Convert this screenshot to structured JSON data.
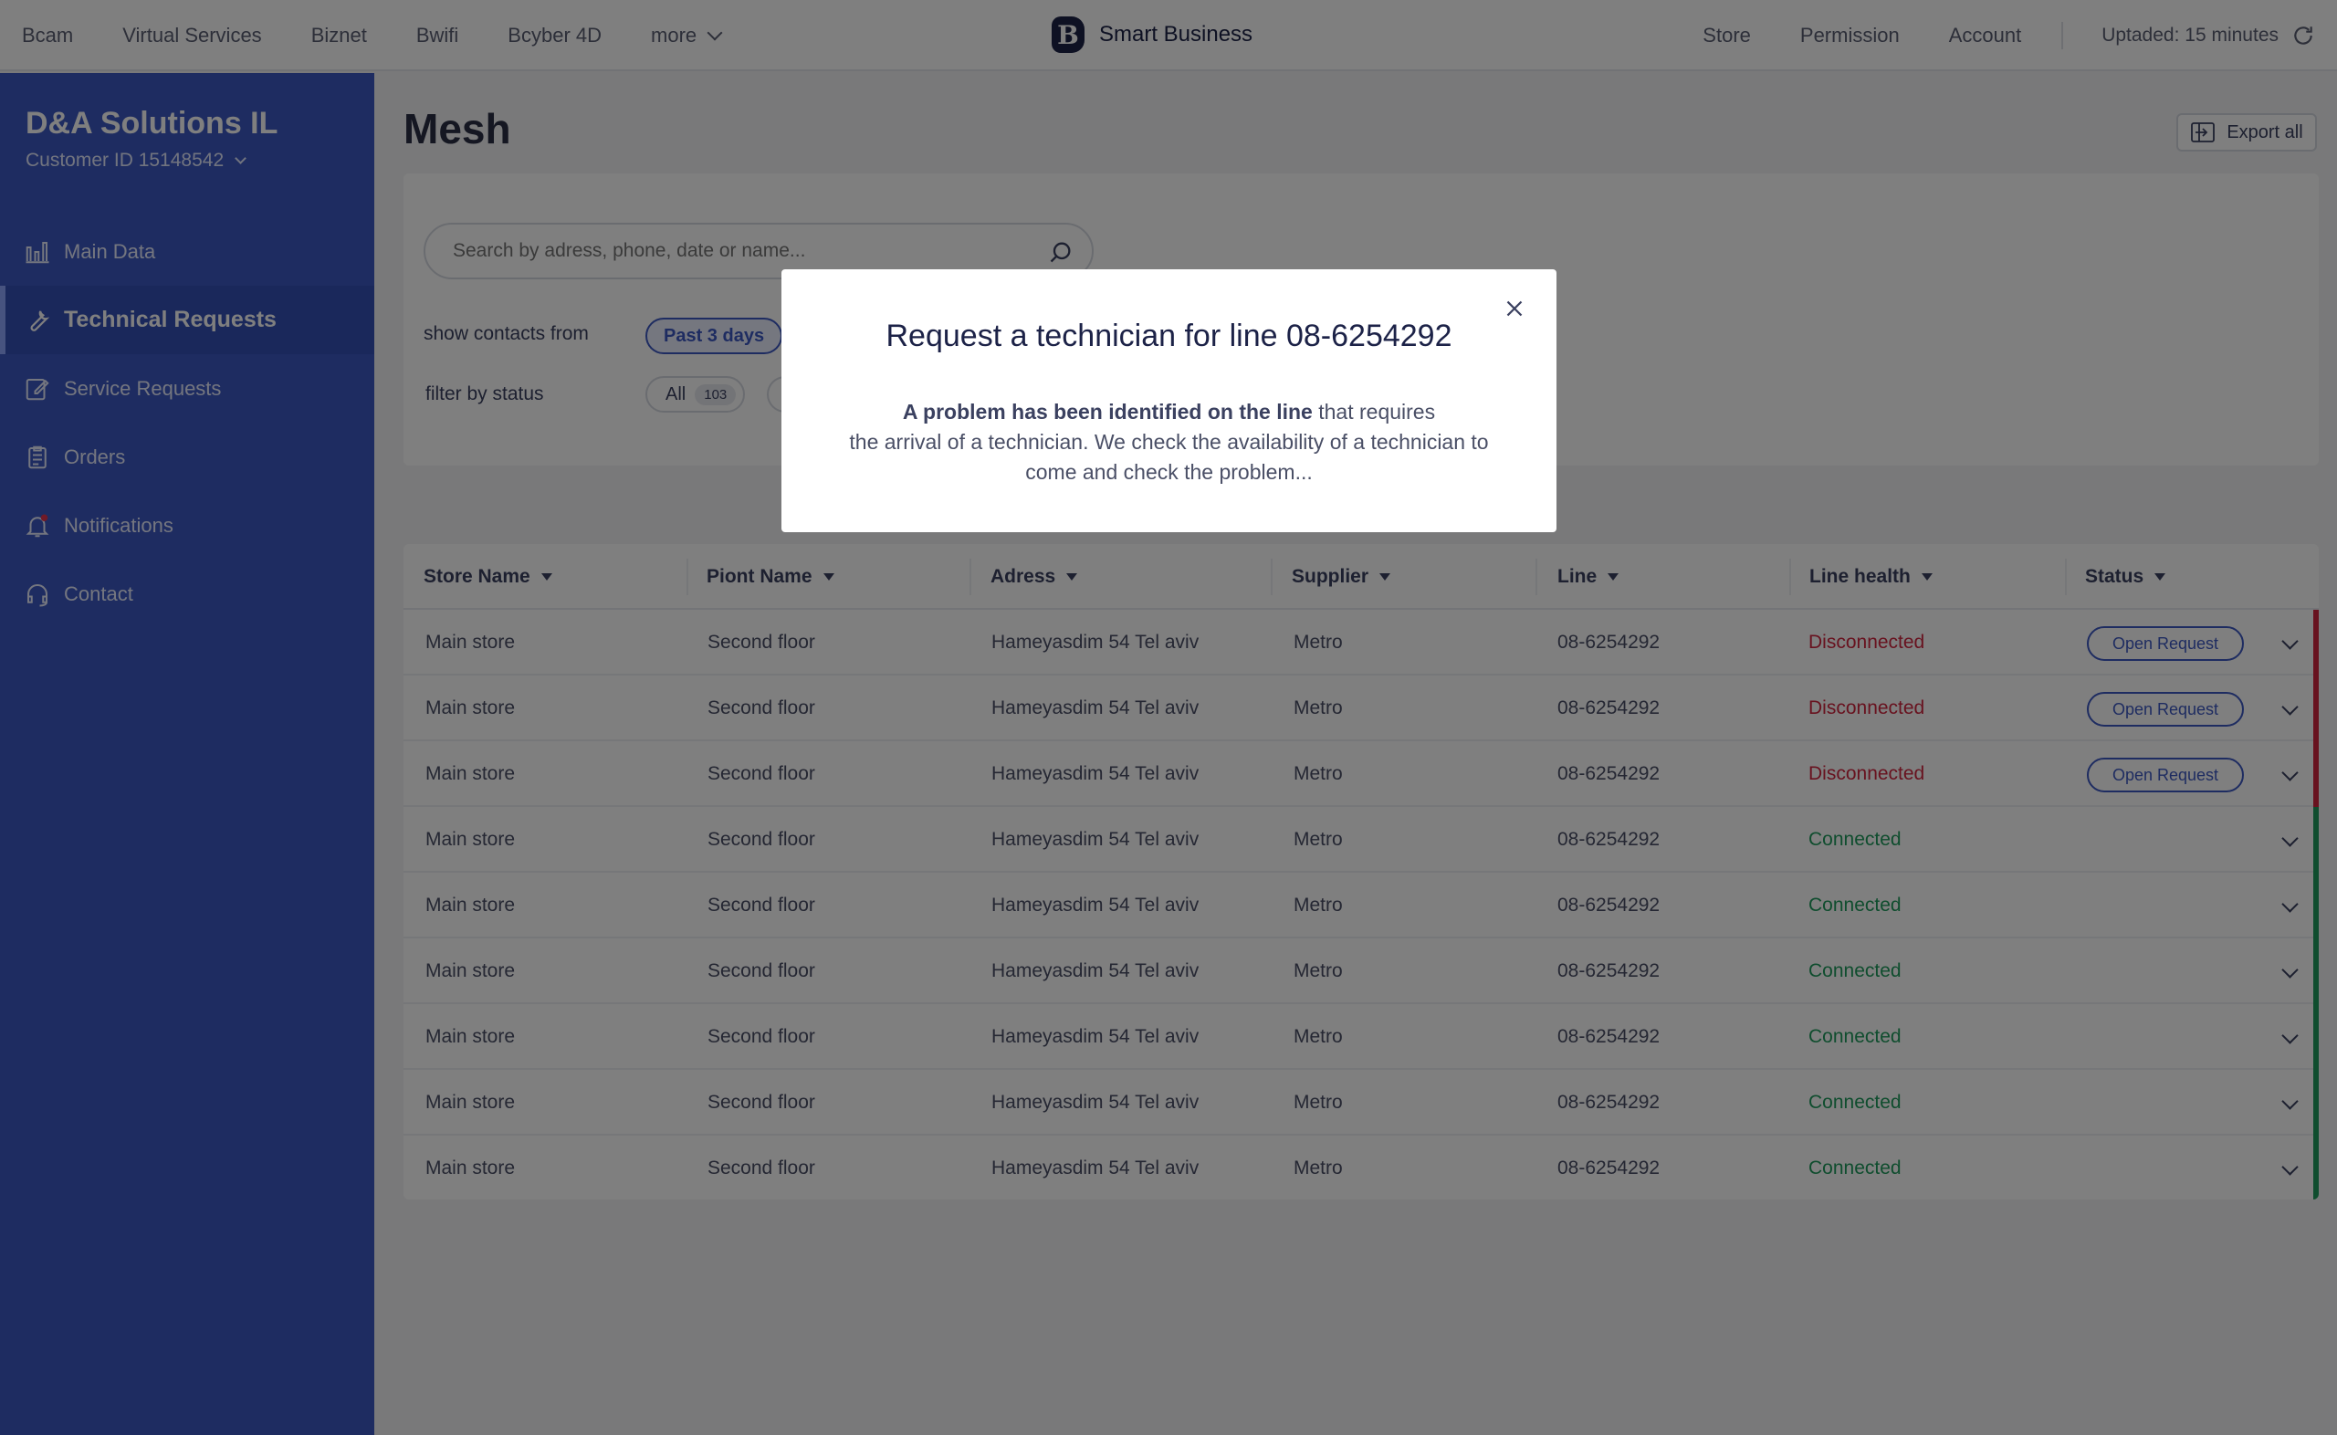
{
  "topnav": {
    "left_links": [
      "Bcam",
      "Virtual Services",
      "Biznet",
      "Bwifi",
      "Bcyber 4D"
    ],
    "more_label": "more",
    "brand_logo": "B",
    "brand_name": "Smart Business",
    "right_links": [
      "Store",
      "Permission",
      "Account"
    ],
    "updated_label": "Uptaded: 15 minutes"
  },
  "sidebar": {
    "company": "D&A Solutions IL",
    "customer_label": "Customer ID  15148542",
    "items": [
      {
        "label": "Main Data",
        "icon": "bar-chart-icon"
      },
      {
        "label": "Technical Requests",
        "icon": "wrench-icon"
      },
      {
        "label": "Service Requests",
        "icon": "edit-icon"
      },
      {
        "label": "Orders",
        "icon": "clipboard-icon"
      },
      {
        "label": "Notifications",
        "icon": "bell-icon"
      },
      {
        "label": "Contact",
        "icon": "headset-icon"
      }
    ],
    "active_index": 1
  },
  "main": {
    "title": "Mesh",
    "export_label": "Export all",
    "search_placeholder": "Search by adress, phone, date or name...",
    "show_contacts_label": "show contacts from",
    "period_chip": "Past 3 days",
    "filter_status_label": "filter by status",
    "status_chip": {
      "label": "All",
      "count": "103"
    }
  },
  "table": {
    "headers": [
      "Store Name",
      "Piont Name",
      "Adress",
      "Supplier",
      "Line",
      "Line health",
      "Status"
    ],
    "rows": [
      {
        "store": "Main store",
        "point": "Second floor",
        "address": "Hameyasdim 54 Tel aviv",
        "supplier": "Metro",
        "line": "08-6254292",
        "health": "Disconnected",
        "status": "Open Request"
      },
      {
        "store": "Main store",
        "point": "Second floor",
        "address": "Hameyasdim 54 Tel aviv",
        "supplier": "Metro",
        "line": "08-6254292",
        "health": "Disconnected",
        "status": "Open Request"
      },
      {
        "store": "Main store",
        "point": "Second floor",
        "address": "Hameyasdim 54 Tel aviv",
        "supplier": "Metro",
        "line": "08-6254292",
        "health": "Disconnected",
        "status": "Open Request"
      },
      {
        "store": "Main store",
        "point": "Second floor",
        "address": "Hameyasdim 54 Tel aviv",
        "supplier": "Metro",
        "line": "08-6254292",
        "health": "Connected",
        "status": ""
      },
      {
        "store": "Main store",
        "point": "Second floor",
        "address": "Hameyasdim 54 Tel aviv",
        "supplier": "Metro",
        "line": "08-6254292",
        "health": "Connected",
        "status": ""
      },
      {
        "store": "Main store",
        "point": "Second floor",
        "address": "Hameyasdim 54 Tel aviv",
        "supplier": "Metro",
        "line": "08-6254292",
        "health": "Connected",
        "status": ""
      },
      {
        "store": "Main store",
        "point": "Second floor",
        "address": "Hameyasdim 54 Tel aviv",
        "supplier": "Metro",
        "line": "08-6254292",
        "health": "Connected",
        "status": ""
      },
      {
        "store": "Main store",
        "point": "Second floor",
        "address": "Hameyasdim 54 Tel aviv",
        "supplier": "Metro",
        "line": "08-6254292",
        "health": "Connected",
        "status": ""
      },
      {
        "store": "Main store",
        "point": "Second floor",
        "address": "Hameyasdim 54 Tel aviv",
        "supplier": "Metro",
        "line": "08-6254292",
        "health": "Connected",
        "status": ""
      }
    ]
  },
  "modal": {
    "title": "Request a technician for line  08-6254292",
    "body_bold": "A problem has been identified on the line",
    "body_line1_rest": " that requires",
    "body_line2": "the arrival of a technician. We check the availability of a technician to",
    "body_line3": "come and check the problem..."
  },
  "colors": {
    "sidebar_bg": "#3d58c2",
    "accent": "#3d58c2",
    "disconnected": "#d0243e",
    "connected": "#1f9a5c",
    "overlay": "rgba(0,0,0,0.5)"
  }
}
